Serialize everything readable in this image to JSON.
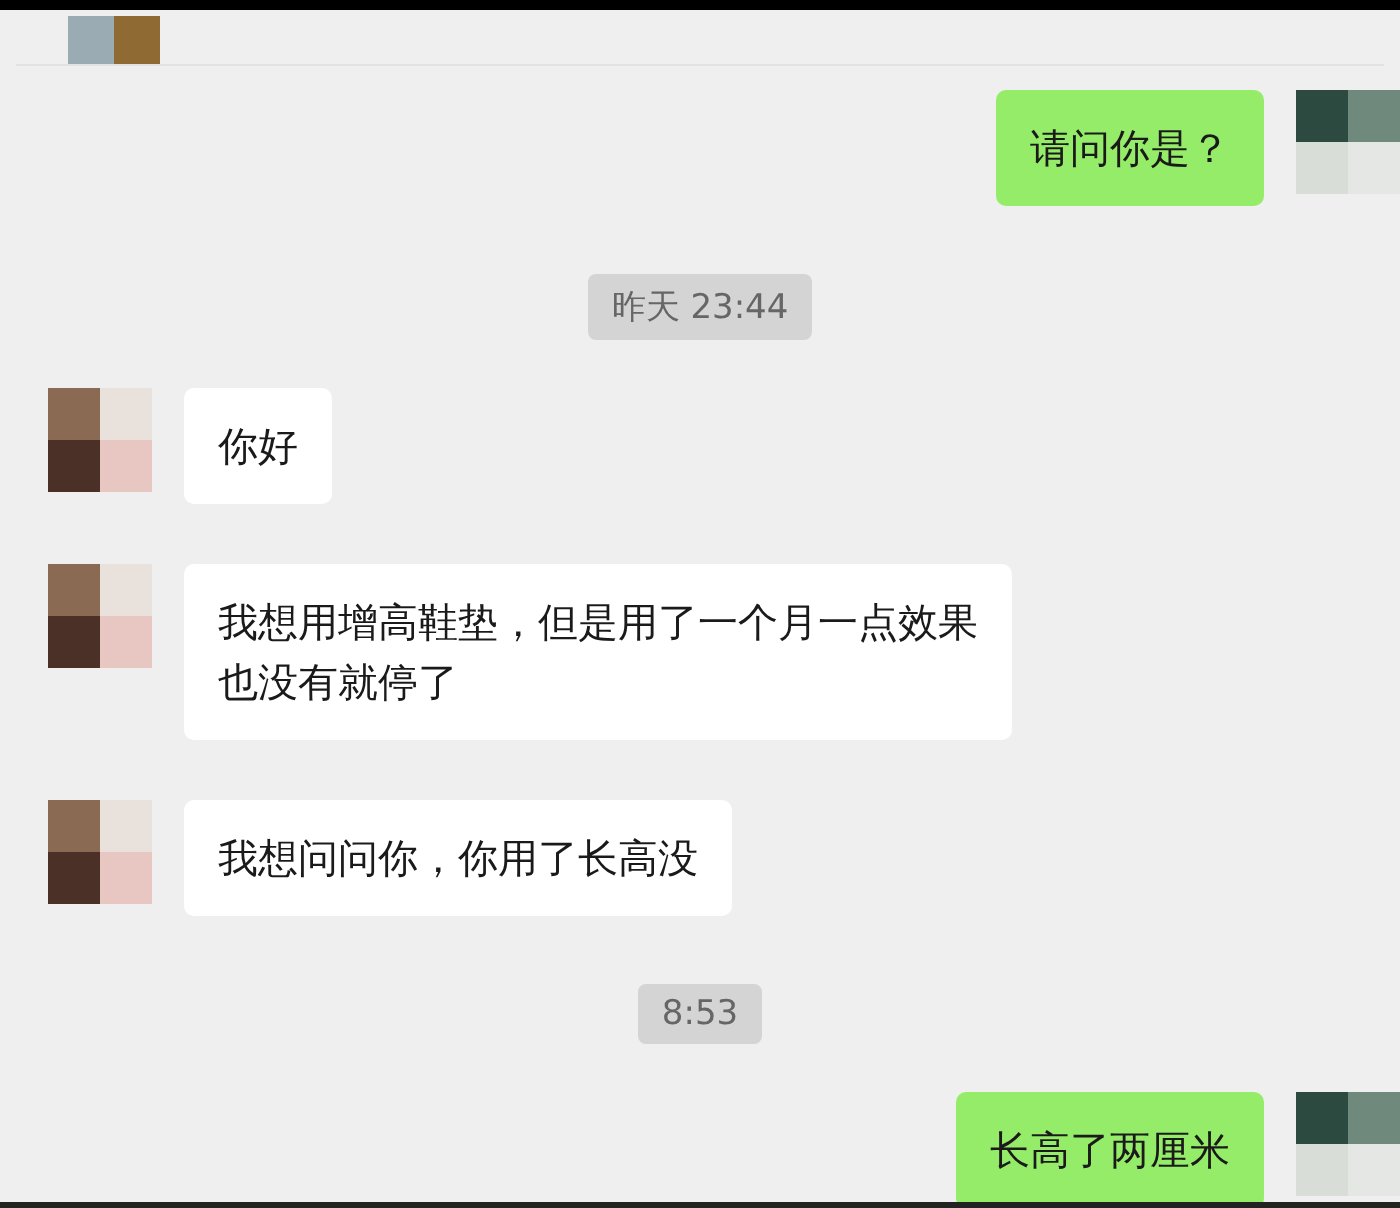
{
  "messages": [
    {
      "kind": "sent",
      "text": "请问你是？"
    },
    {
      "kind": "time",
      "text": "昨天 23:44"
    },
    {
      "kind": "received",
      "text": "你好"
    },
    {
      "kind": "received",
      "text": "我想用增高鞋垫，但是用了一个月一点效果也没有就停了"
    },
    {
      "kind": "received",
      "text": "我想问问你，你用了长高没"
    },
    {
      "kind": "time",
      "text": "8:53"
    },
    {
      "kind": "sent",
      "text": "长高了两厘米"
    }
  ]
}
